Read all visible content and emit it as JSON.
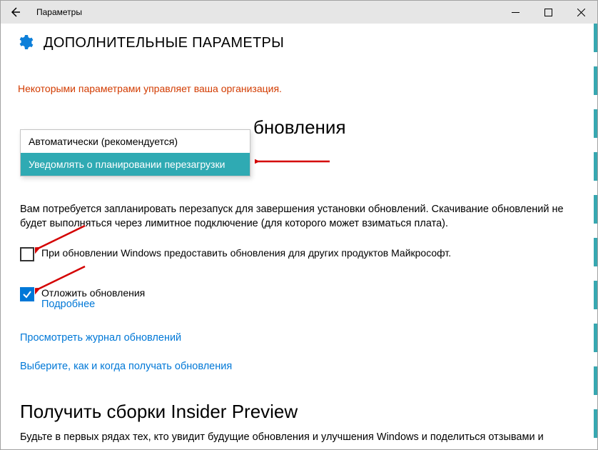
{
  "titlebar": {
    "app_title": "Параметры"
  },
  "header": {
    "title": "ДОПОЛНИТЕЛЬНЫЕ ПАРАМЕТРЫ"
  },
  "warning": "Некоторыми параметрами управляет ваша организация.",
  "heading_partial": "бновления",
  "dropdown": {
    "option_auto": "Автоматически (рекомендуется)",
    "option_notify": "Уведомлять о планировании перезагрузки"
  },
  "explain_text": "Вам потребуется запланировать перезапуск для завершения установки обновлений. Скачивание обновлений не будет выполняться через лимитное подключение (для которого может взиматься плата).",
  "checkbox1_label": "При обновлении Windows предоставить обновления для других продуктов Майкрософт.",
  "checkbox2_label": "Отложить обновления",
  "checkbox2_link": "Подробнее",
  "link_history": "Просмотреть журнал обновлений",
  "link_choose": "Выберите, как и когда получать обновления",
  "heading_insider": "Получить сборки Insider Preview",
  "insider_text": "Будьте в первых рядах тех, кто увидит будущие обновления и улучшения Windows и поделиться отзывами и"
}
